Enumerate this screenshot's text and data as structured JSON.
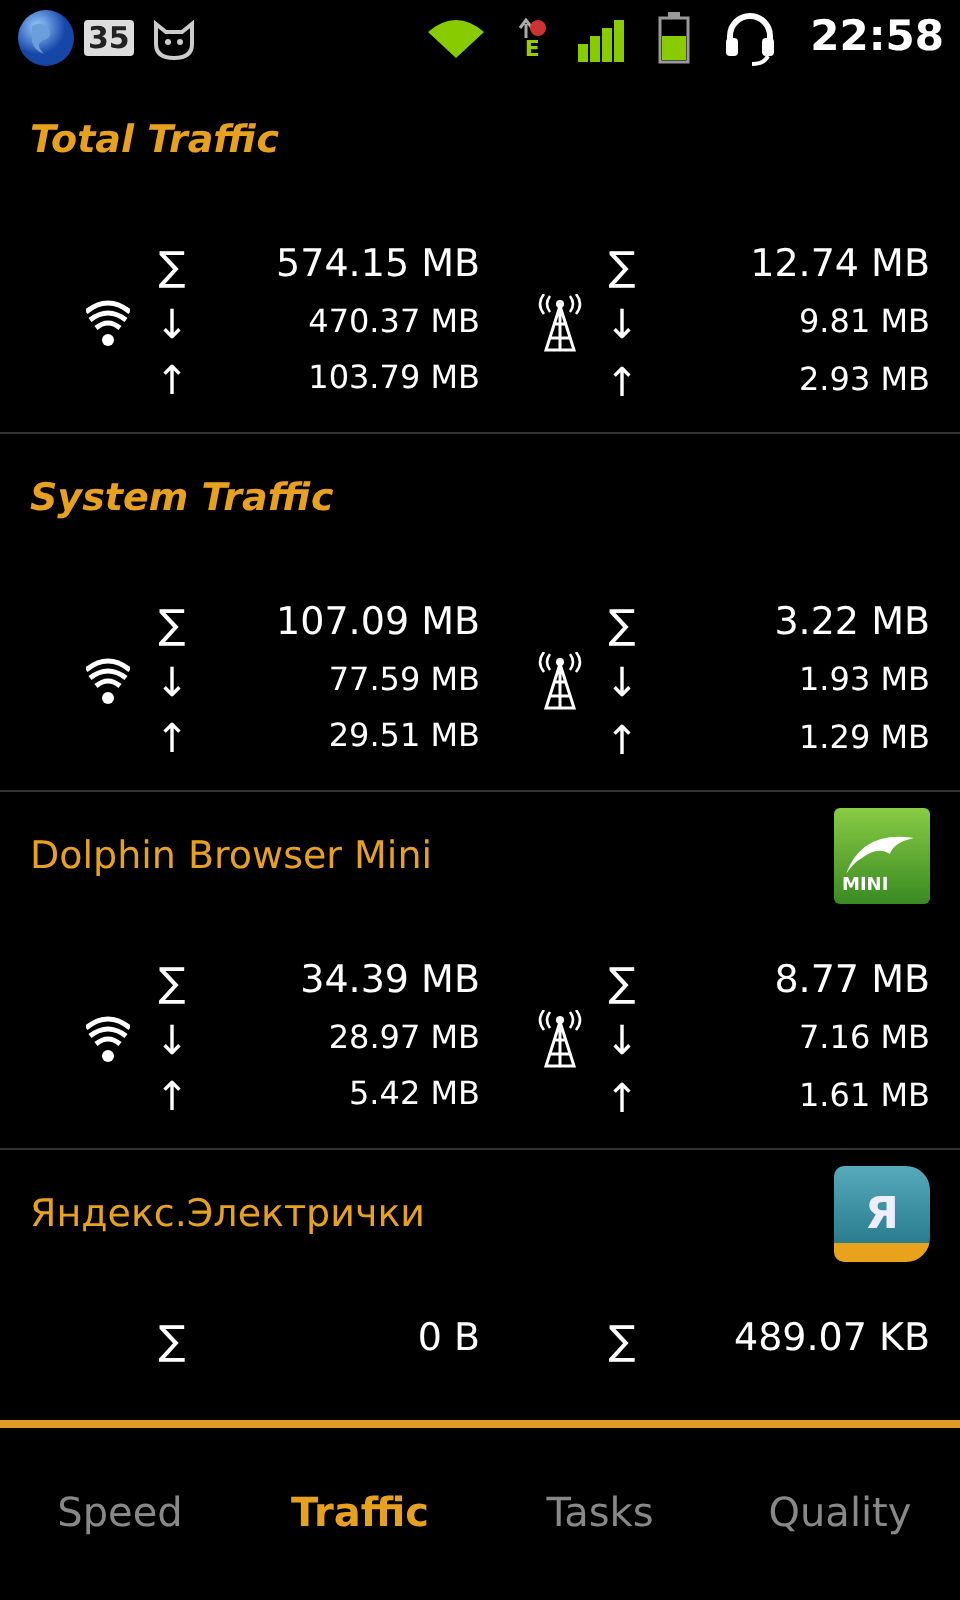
{
  "status_bar": {
    "battery_badge": "35",
    "data_type": "E",
    "time": "22:58"
  },
  "sections": [
    {
      "kind": "summary",
      "title": "Total Traffic",
      "wifi": {
        "total": "574.15 MB",
        "down": "470.37 MB",
        "up": "103.79 MB"
      },
      "mobile": {
        "total": "12.74 MB",
        "down": "9.81 MB",
        "up": "2.93 MB"
      }
    },
    {
      "kind": "summary",
      "title": "System Traffic",
      "wifi": {
        "total": "107.09 MB",
        "down": "77.59 MB",
        "up": "29.51 MB"
      },
      "mobile": {
        "total": "3.22 MB",
        "down": "1.93 MB",
        "up": "1.29 MB"
      }
    },
    {
      "kind": "app",
      "title": "Dolphin Browser Mini",
      "icon_label": "MINI",
      "wifi": {
        "total": "34.39 MB",
        "down": "28.97 MB",
        "up": "5.42 MB"
      },
      "mobile": {
        "total": "8.77 MB",
        "down": "7.16 MB",
        "up": "1.61 MB"
      }
    },
    {
      "kind": "app",
      "title": "Яндекс.Электрички",
      "icon_label": "Я",
      "wifi": {
        "total": "0 B"
      },
      "mobile": {
        "total": "489.07 KB"
      }
    }
  ],
  "symbols": {
    "total": "∑",
    "down": "↓",
    "up": "↑"
  },
  "tabs": [
    {
      "label": "Speed",
      "selected": false
    },
    {
      "label": "Traffic",
      "selected": true
    },
    {
      "label": "Tasks",
      "selected": false
    },
    {
      "label": "Quality",
      "selected": false
    }
  ]
}
